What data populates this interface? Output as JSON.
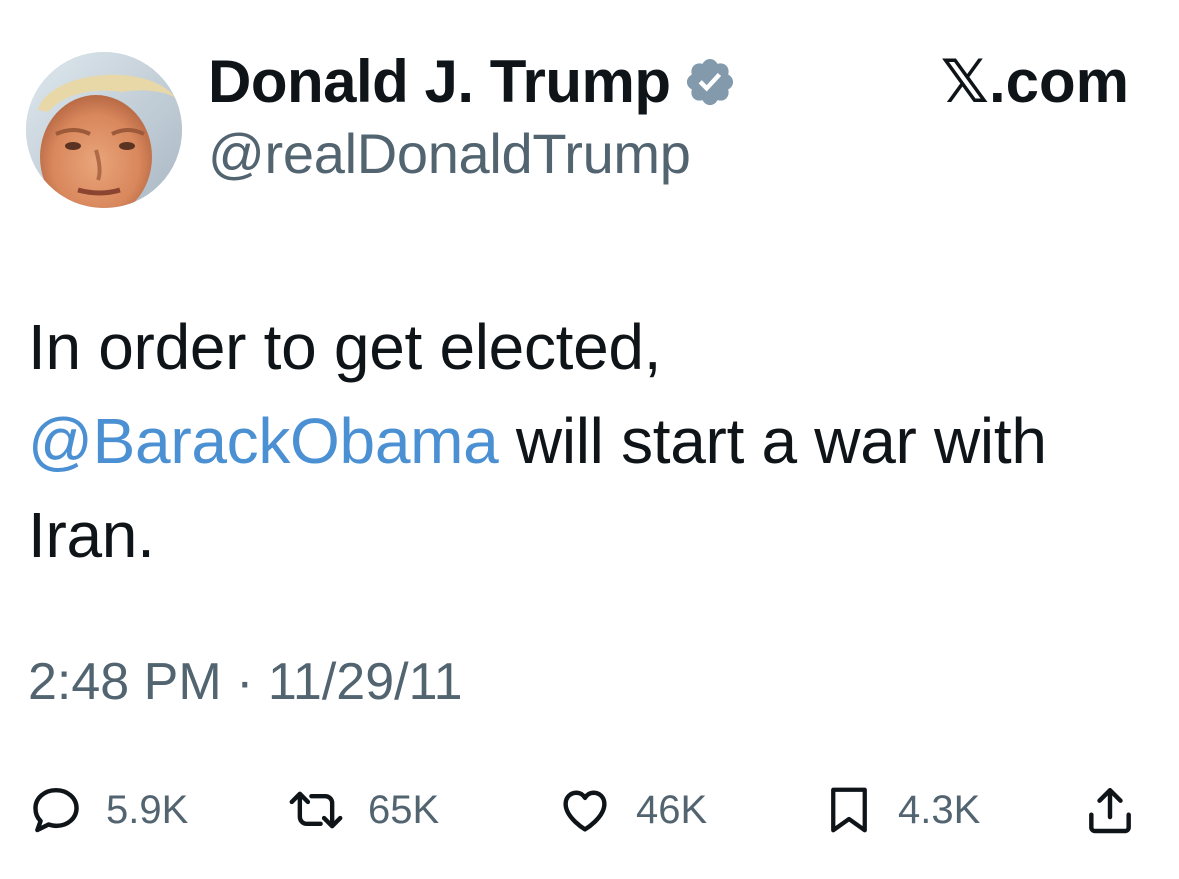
{
  "author": {
    "display_name": "Donald J. Trump",
    "handle": "@realDonaldTrump",
    "verified": true,
    "avatar_icon": "profile-photo"
  },
  "site": {
    "label": "𝕏.com"
  },
  "tweet": {
    "text_before": "In order to get elected, ",
    "mention": "@BarackObama",
    "text_after": " will start a war with Iran.",
    "timestamp": "2:48 PM · 11/29/11"
  },
  "actions": {
    "reply": {
      "icon": "reply-icon",
      "count": "5.9K"
    },
    "retweet": {
      "icon": "retweet-icon",
      "count": "65K"
    },
    "like": {
      "icon": "heart-icon",
      "count": "46K"
    },
    "bookmark": {
      "icon": "bookmark-icon",
      "count": "4.3K"
    },
    "share": {
      "icon": "share-icon"
    }
  },
  "colors": {
    "text": "#0f1419",
    "secondary": "#536471",
    "mention": "#4a90d2",
    "verified_badge": "#829aab"
  }
}
